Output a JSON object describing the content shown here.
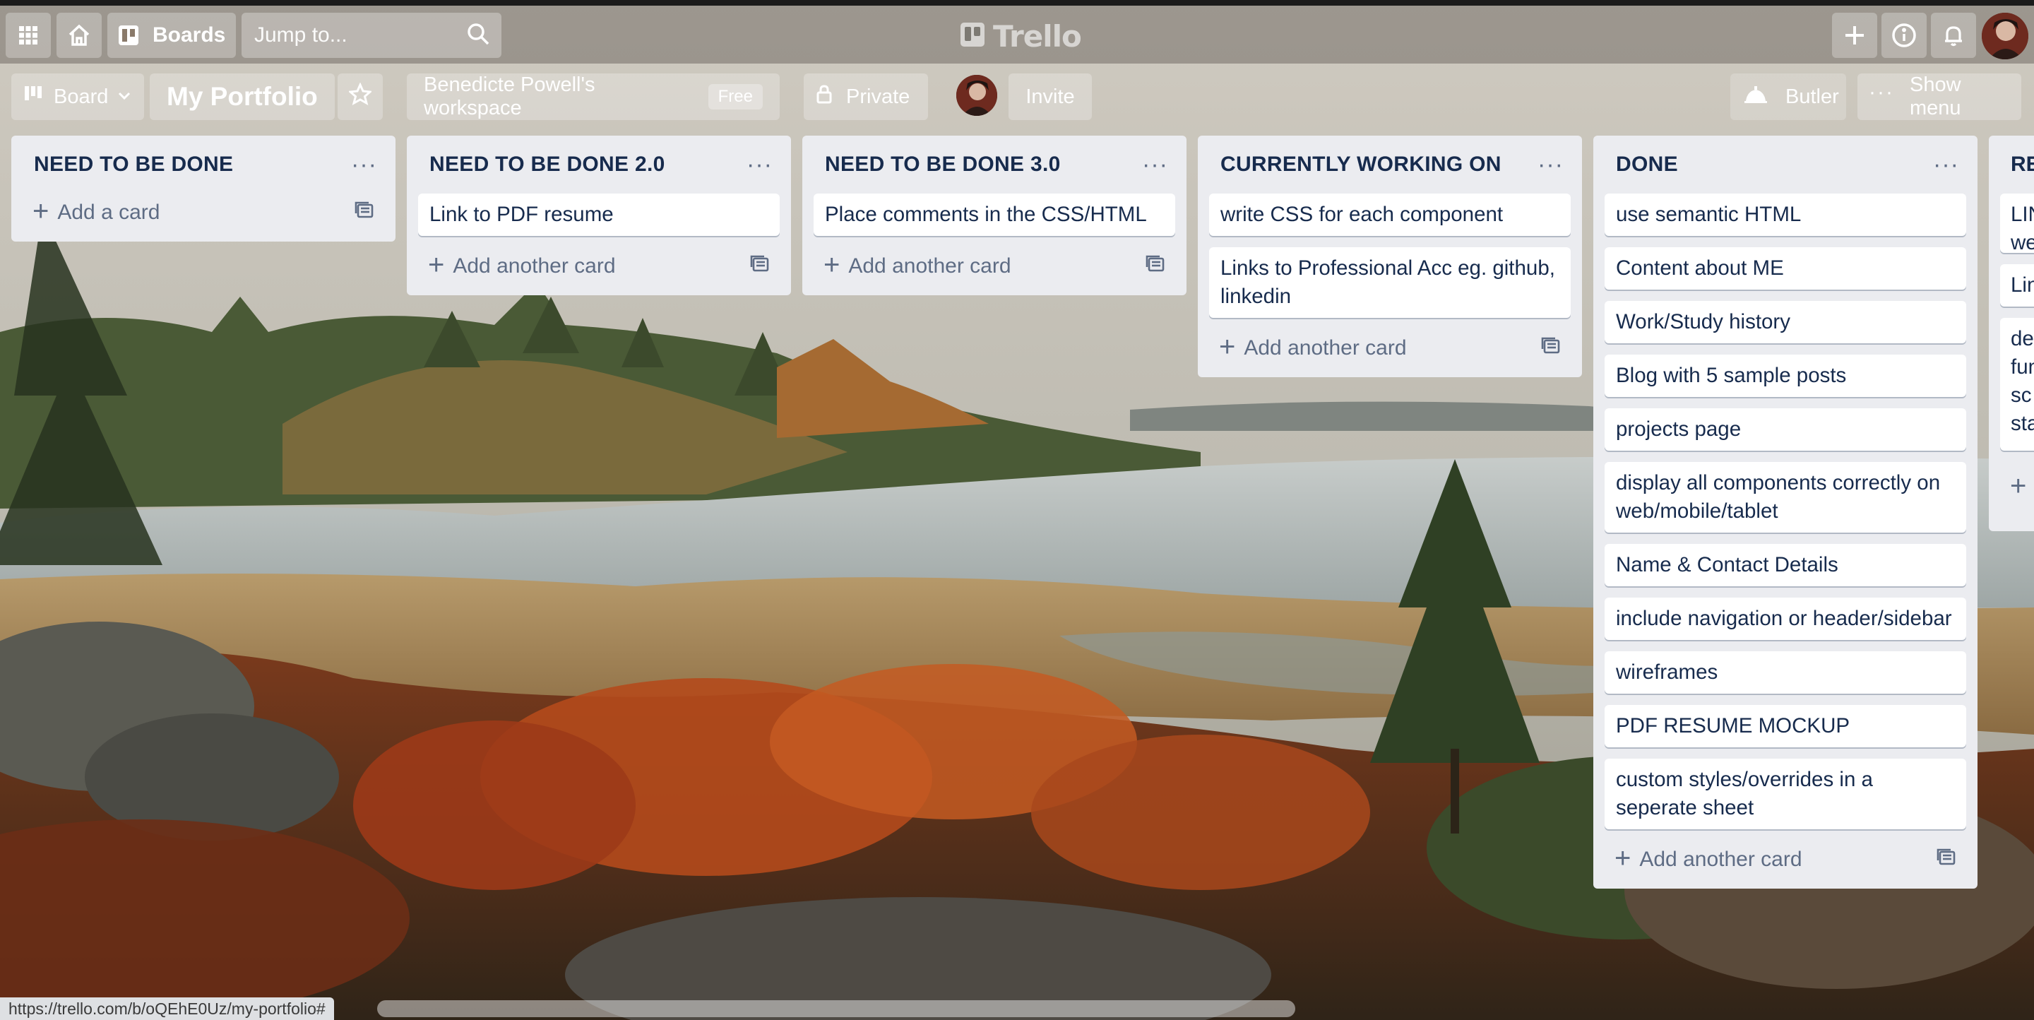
{
  "app": {
    "logo_text": "Trello",
    "search_placeholder": "Jump to...",
    "boards_label": "Boards"
  },
  "board": {
    "view_label": "Board",
    "title": "My Portfolio",
    "workspace_label": "Benedicte Powell's workspace",
    "workspace_badge": "Free",
    "privacy_label": "Private",
    "invite_label": "Invite",
    "butler_label": "Butler",
    "show_menu_label": "Show menu"
  },
  "lists": [
    {
      "title": "NEED TO BE DONE",
      "cards": [],
      "add_label": "Add a card"
    },
    {
      "title": "NEED TO BE DONE 2.0",
      "cards": [
        "Link to PDF resume"
      ],
      "add_label": "Add another card"
    },
    {
      "title": "NEED TO BE DONE 3.0",
      "cards": [
        "Place comments in the CSS/HTML"
      ],
      "add_label": "Add another card"
    },
    {
      "title": "CURRENTLY WORKING ON",
      "cards": [
        "write CSS for each component",
        "Links to Professional Acc eg. github, linkedin"
      ],
      "add_label": "Add another card"
    },
    {
      "title": "DONE",
      "cards": [
        "use semantic HTML",
        "Content about ME",
        "Work/Study history",
        "Blog with 5 sample posts",
        "projects page",
        "display all components correctly on web/mobile/tablet",
        "Name & Contact Details",
        "include navigation or header/sidebar",
        "wireframes",
        "PDF RESUME MOCKUP",
        "custom styles/overrides in a seperate sheet"
      ],
      "add_label": "Add another card"
    }
  ],
  "partial_list": {
    "title": "RE",
    "cards": [
      "LIN",
      "we",
      "Lin",
      "de",
      "fun",
      "sc",
      "sta"
    ]
  },
  "status_url": "https://trello.com/b/oQEhE0Uz/my-portfolio#",
  "colors": {
    "list_bg": "#ebecf0",
    "card_text": "#172b4d",
    "muted_text": "#5e6c84"
  }
}
